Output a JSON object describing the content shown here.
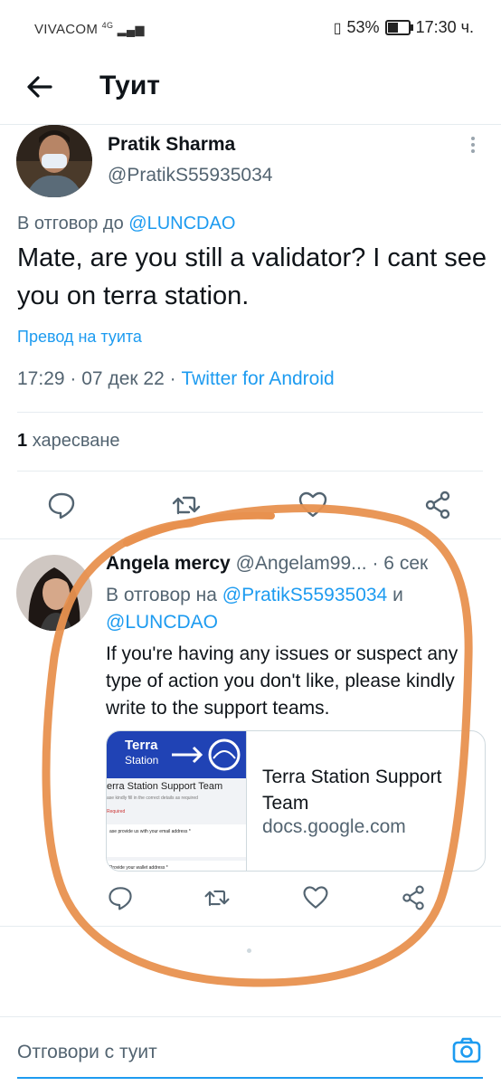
{
  "status_bar": {
    "carrier": "VIVACOM",
    "network": "4G",
    "battery": "53%",
    "battery_level": 0.53,
    "time": "17:30 ч."
  },
  "header": {
    "title": "Туит"
  },
  "main_tweet": {
    "author_name": "Pratik Sharma",
    "handle": "@PratikS55935034",
    "reply_prefix": "В отговор до",
    "reply_handle": "@LUNCDAO",
    "text": "Mate, are you still a validator? I cant see you on terra station.",
    "translate": "Превод на туита",
    "time": "17:29",
    "date": "07 дек 22",
    "source": "Twitter for Android",
    "likes_count": "1",
    "likes_label": "харесване"
  },
  "reply_tweet": {
    "author_name": "Angela mercy",
    "handle_time": "@Angelam99... · 6 сек",
    "reply_prefix": "В отговор на",
    "reply_handle_1": "@PratikS55935034",
    "reply_and": "и",
    "reply_handle_2": "@LUNCDAO",
    "text": "If you're having any issues or suspect any type of action you don't like, please kindly write to the support teams.",
    "card": {
      "title": "Terra Station Support Team",
      "domain": "docs.google.com",
      "thumb_brand": "Terra",
      "thumb_brand_sub": "Station",
      "thumb_form_title": "erra Station Support Team",
      "thumb_line1": "ase kindly fill in the correct details as required",
      "thumb_required": "Required",
      "thumb_q1": "ase provide us with your email address *",
      "thumb_q2": "Provide your wallet address *"
    }
  },
  "reply_box": {
    "placeholder": "Отговори с туит"
  },
  "colors": {
    "accent": "#1d9bf0",
    "scribble": "#e8914f",
    "text": "#0f1419",
    "muted": "#536471"
  }
}
